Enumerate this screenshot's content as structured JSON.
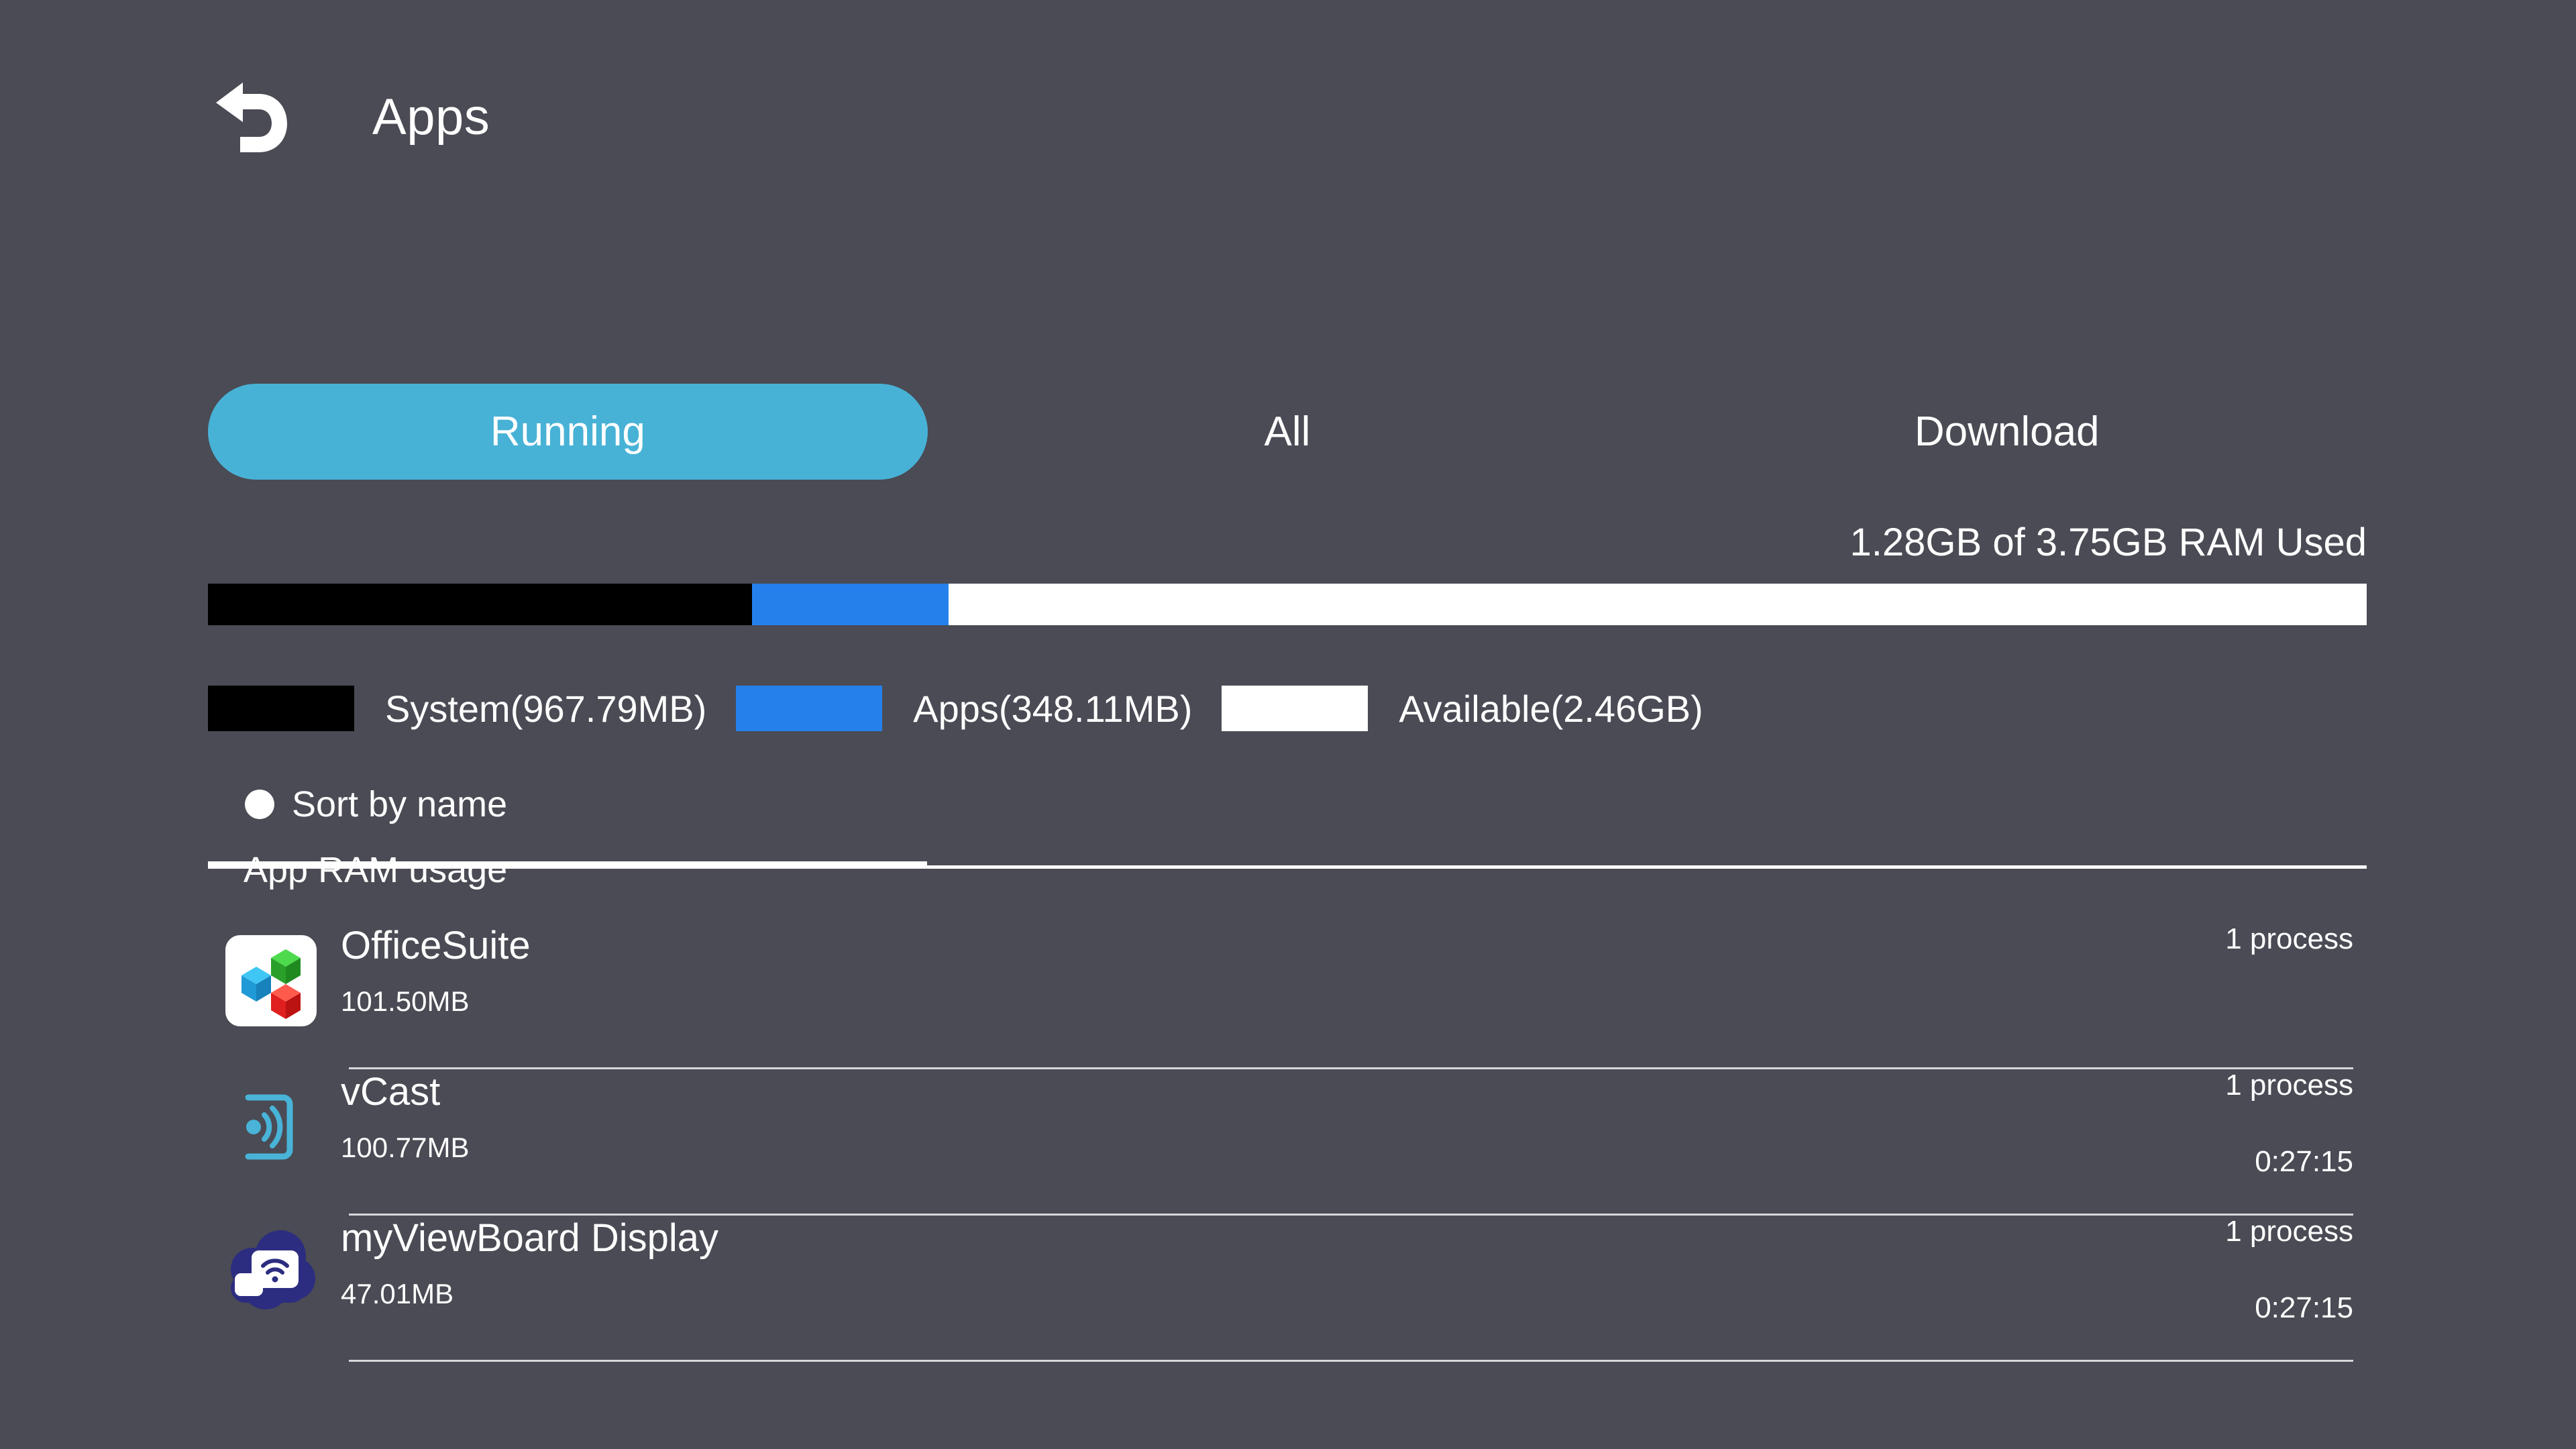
{
  "header": {
    "back_icon": "back-arrow-icon",
    "title": "Apps"
  },
  "tabs": [
    {
      "label": "Running",
      "active": true
    },
    {
      "label": "All",
      "active": false
    },
    {
      "label": "Download",
      "active": false
    }
  ],
  "memory": {
    "summary": "1.28GB of 3.75GB RAM Used",
    "used": "1.28GB",
    "total": "3.75GB",
    "bar": {
      "system_pct": 25.2,
      "apps_pct": 9.1,
      "available_pct": 65.7
    },
    "legend": [
      {
        "label": "System(967.79MB)",
        "color": "#000000",
        "name": "system"
      },
      {
        "label": "Apps(348.11MB)",
        "color": "#2680eb",
        "name": "apps"
      },
      {
        "label": "Available(2.46GB)",
        "color": "#ffffff",
        "name": "available"
      }
    ]
  },
  "sort": {
    "label": "Sort by name",
    "selected": true
  },
  "list_header": "App RAM usage",
  "apps": [
    {
      "name": "OfficeSuite",
      "memory": "101.50MB",
      "processes": "1 process",
      "time": "",
      "icon": "officesuite-icon"
    },
    {
      "name": "vCast",
      "memory": "100.77MB",
      "processes": "1 process",
      "time": "0:27:15",
      "icon": "vcast-icon"
    },
    {
      "name": "myViewBoard Display",
      "memory": "47.01MB",
      "processes": "1 process",
      "time": "0:27:15",
      "icon": "myviewboard-display-icon"
    }
  ],
  "colors": {
    "background": "#4a4b54",
    "accent": "#48b2d6",
    "apps_blue": "#2680eb",
    "system_black": "#000000",
    "available_white": "#ffffff",
    "divider": "#d7d7da"
  }
}
